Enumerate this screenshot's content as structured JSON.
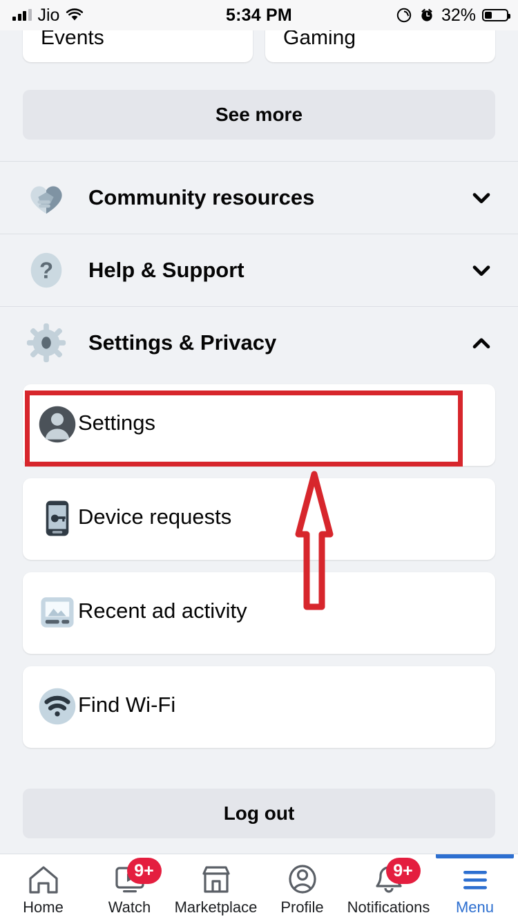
{
  "status_bar": {
    "carrier": "Jio",
    "time": "5:34 PM",
    "battery_percent": "32%",
    "icons": [
      "signal-bars-icon",
      "wifi-icon",
      "rotation-lock-icon",
      "alarm-icon",
      "battery-icon"
    ]
  },
  "top_cards": [
    {
      "label": "Events"
    },
    {
      "label": "Gaming"
    }
  ],
  "see_more": {
    "label": "See more"
  },
  "sections": [
    {
      "label": "Community resources",
      "icon": "handshake-heart-icon",
      "chevron": "chevron-down-icon",
      "expanded": false
    },
    {
      "label": "Help & Support",
      "icon": "question-mark-icon",
      "chevron": "chevron-down-icon",
      "expanded": false
    },
    {
      "label": "Settings & Privacy",
      "icon": "gear-icon",
      "chevron": "chevron-up-icon",
      "expanded": true
    }
  ],
  "settings_items": [
    {
      "label": "Settings",
      "icon": "person-avatar-icon",
      "highlighted": true
    },
    {
      "label": "Device requests",
      "icon": "phone-key-icon",
      "highlighted": false
    },
    {
      "label": "Recent ad activity",
      "icon": "ad-image-icon",
      "highlighted": false
    },
    {
      "label": "Find Wi-Fi",
      "icon": "wifi-circle-icon",
      "highlighted": false
    }
  ],
  "logout": {
    "label": "Log out"
  },
  "annotation": {
    "highlight_color": "#d7262c",
    "target": "Settings",
    "arrow": "up-arrow-outline"
  },
  "tabbar": [
    {
      "label": "Home",
      "icon": "home-icon",
      "badge": "",
      "active": false
    },
    {
      "label": "Watch",
      "icon": "watch-play-icon",
      "badge": "9+",
      "active": false
    },
    {
      "label": "Marketplace",
      "icon": "storefront-icon",
      "badge": "",
      "active": false
    },
    {
      "label": "Profile",
      "icon": "profile-circle-icon",
      "badge": "",
      "active": false
    },
    {
      "label": "Notifications",
      "icon": "bell-icon",
      "badge": "9+",
      "active": false
    },
    {
      "label": "Menu",
      "icon": "hamburger-menu-icon",
      "badge": "",
      "active": true
    }
  ],
  "colors": {
    "accent_blue": "#2d6fd0",
    "badge_red": "#e41e3f",
    "annotation_red": "#d7262c",
    "page_bg": "#f0f2f5",
    "card_bg": "#ffffff",
    "button_bg": "#e4e6eb"
  }
}
